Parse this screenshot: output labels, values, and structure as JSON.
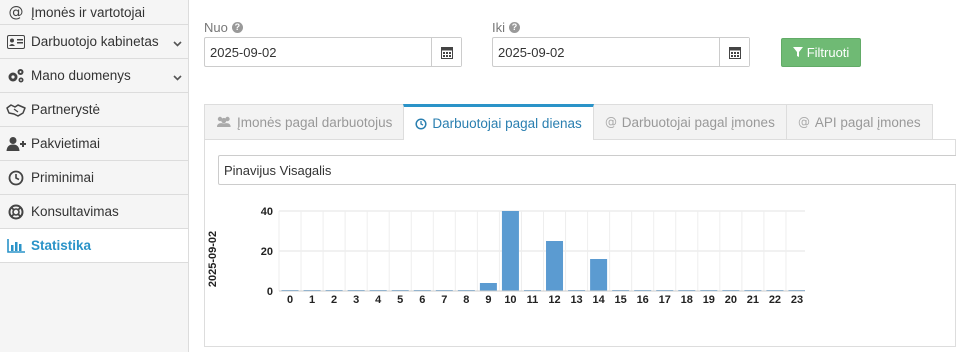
{
  "sidebar": {
    "items": [
      {
        "label": "Įmonės ir vartotojai",
        "icon": "at-icon"
      },
      {
        "label": "Darbuotojo kabinetas",
        "icon": "id-card-icon",
        "expandable": true
      },
      {
        "label": "Mano duomenys",
        "icon": "gears-icon",
        "expandable": true
      },
      {
        "label": "Partnerystė",
        "icon": "handshake-icon"
      },
      {
        "label": "Pakvietimai",
        "icon": "user-plus-icon"
      },
      {
        "label": "Priminimai",
        "icon": "clock-icon"
      },
      {
        "label": "Konsultavimas",
        "icon": "life-ring-icon"
      },
      {
        "label": "Statistika",
        "icon": "bar-chart-icon",
        "active": true
      }
    ]
  },
  "filters": {
    "from_label": "Nuo",
    "from_value": "2025-09-02",
    "to_label": "Iki",
    "to_value": "2025-09-02",
    "filter_button": "Filtruoti"
  },
  "tabs": [
    {
      "label": "Įmonės pagal darbuotojus",
      "icon": "users-icon",
      "active": false
    },
    {
      "label": "Darbuotojai pagal dienas",
      "icon": "clock-icon",
      "active": true
    },
    {
      "label": "Darbuotojai pagal įmones",
      "icon": "at-icon",
      "active": false
    },
    {
      "label": "API pagal įmones",
      "icon": "at-icon",
      "active": false
    }
  ],
  "employee_select": "Pinavijus Visagalis",
  "colors": {
    "accent": "#2a93c8",
    "bar": "#5b9bd1",
    "button_green": "#6fba74"
  },
  "chart_data": {
    "type": "bar",
    "categories": [
      "0",
      "1",
      "2",
      "3",
      "4",
      "5",
      "6",
      "7",
      "8",
      "9",
      "10",
      "11",
      "12",
      "13",
      "14",
      "15",
      "16",
      "17",
      "18",
      "19",
      "20",
      "21",
      "22",
      "23"
    ],
    "values": [
      0,
      0,
      0,
      0,
      0,
      0,
      0,
      0,
      0,
      4,
      40,
      0,
      25,
      0,
      16,
      0,
      0,
      0,
      0,
      0,
      0,
      0,
      0,
      0
    ],
    "ylabel": "2025-09-02",
    "yticks": [
      0,
      20,
      40
    ],
    "ylim": [
      0,
      40
    ],
    "grid": true
  }
}
